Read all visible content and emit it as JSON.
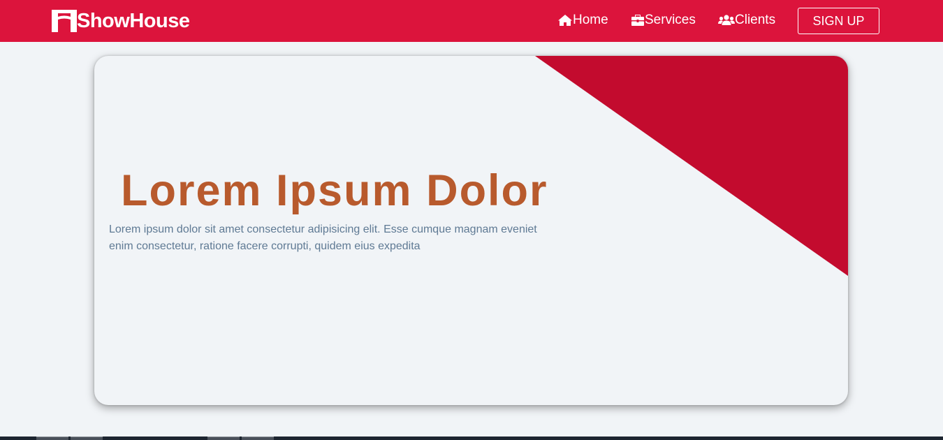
{
  "brand": {
    "name": "ShowHouse",
    "icon": "gate-logo-icon"
  },
  "nav": {
    "items": [
      {
        "label": "Home",
        "icon": "house-icon"
      },
      {
        "label": "Services",
        "icon": "toolbox-icon"
      },
      {
        "label": "Clients",
        "icon": "users-icon"
      }
    ],
    "signup_label": "SIGN UP"
  },
  "hero": {
    "title": "Lorem Ipsum Dolor",
    "text": "Lorem ipsum dolor sit amet consectetur adipisicing elit. Esse cumque magnam eveniet enim consectetur, ratione facere corrupti, quidem eius expedita"
  },
  "colors": {
    "primary": "#dc143c",
    "accent_triangle": "#c30b2e",
    "title": "#b85a2d",
    "body_text": "#5f7a94",
    "background": "#f1f4f7"
  }
}
